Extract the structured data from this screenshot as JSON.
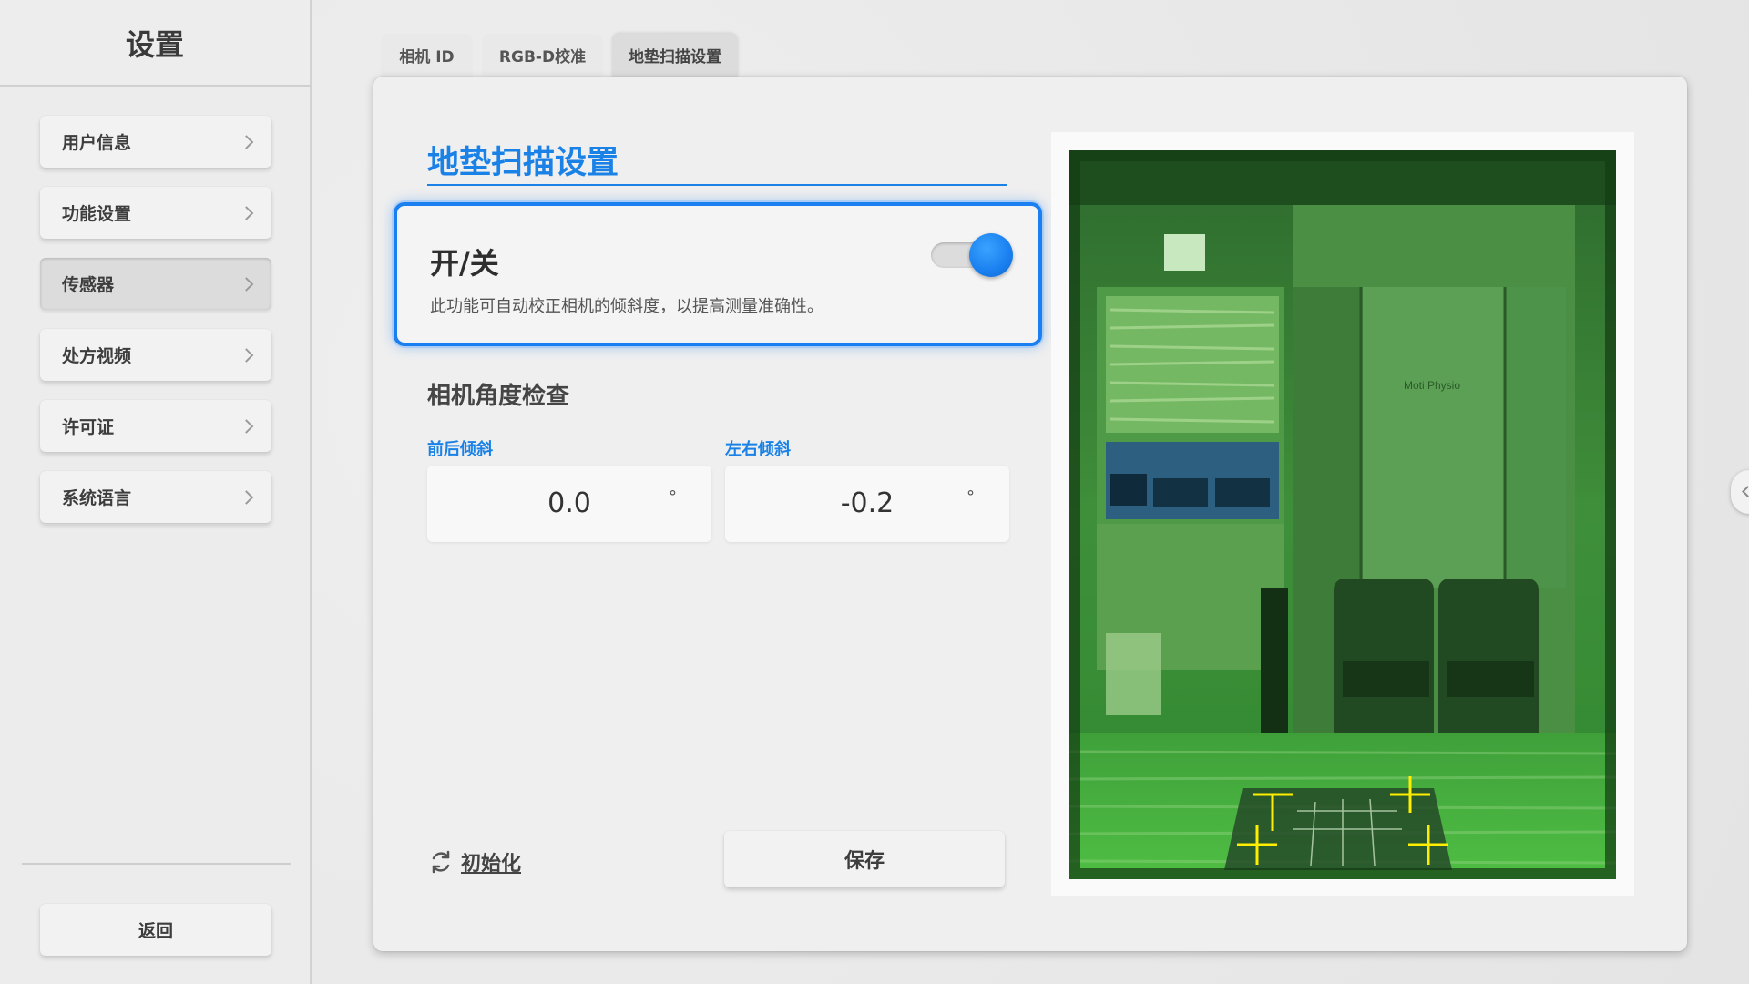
{
  "sidebar": {
    "title": "设置",
    "items": [
      {
        "label": "用户信息"
      },
      {
        "label": "功能设置"
      },
      {
        "label": "传感器"
      },
      {
        "label": "处方视频"
      },
      {
        "label": "许可证"
      },
      {
        "label": "系统语言"
      }
    ],
    "active_index": 2,
    "back_label": "返回"
  },
  "tabs": [
    {
      "label": "相机 ID"
    },
    {
      "label": "RGB-D校准"
    },
    {
      "label": "地垫扫描设置"
    }
  ],
  "active_tab": 2,
  "main": {
    "section_title": "地垫扫描设置",
    "switch": {
      "title": "开/关",
      "description": "此功能可自动校正相机的倾斜度，以提高测量准确性。",
      "state": "on"
    },
    "angle_check_title": "相机角度检查",
    "front_back": {
      "label": "前后倾斜",
      "value": "0.0",
      "unit": "°"
    },
    "left_right": {
      "label": "左右倾斜",
      "value": "-0.2",
      "unit": "°"
    },
    "reset_label": "初始化",
    "save_label": "保存"
  },
  "preview": {
    "wall_sign": "Moti Physio"
  },
  "colors": {
    "accent": "#1a82e6",
    "marker": "#ffee00",
    "overlay_green": "#2fbf2f"
  },
  "icons": {
    "menu_chevron": "chevron-right-icon",
    "reset": "refresh-icon",
    "edge_handle": "chevron-left-icon"
  }
}
